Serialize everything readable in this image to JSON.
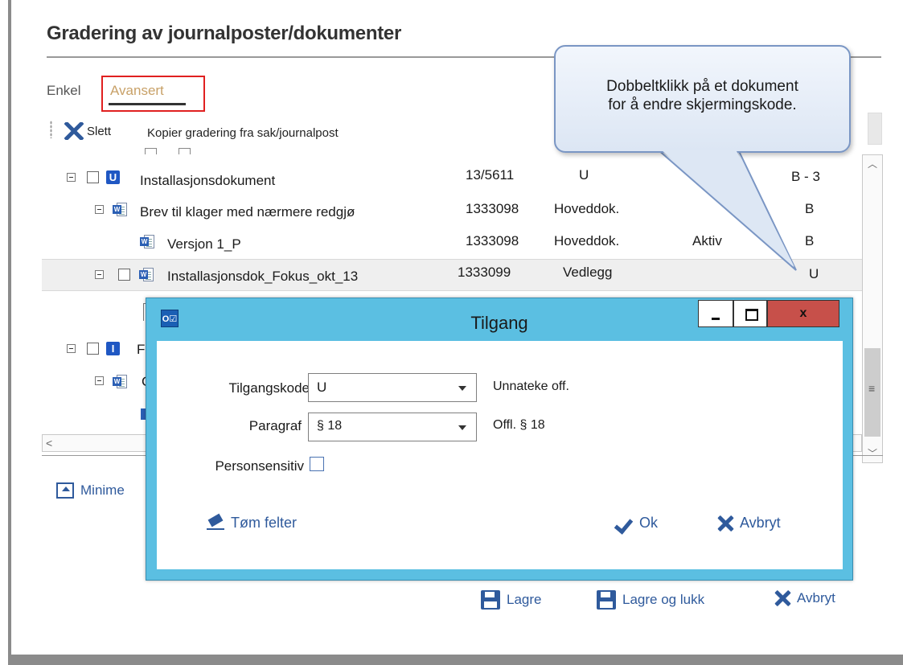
{
  "page": {
    "title": "Gradering av journalposter/dokumenter"
  },
  "tabs": {
    "enkel": "Enkel",
    "avansert": "Avansert"
  },
  "toolbar": {
    "delete_label": "Slett",
    "copy_label": "Kopier gradering fra sak/journalpost"
  },
  "callout": {
    "line1": "Dobbeltklikk på et dokument",
    "line2": "for å endre skjermingskode."
  },
  "grid": {
    "rows": [
      {
        "name": "Installasjonsdokument",
        "number": "13/5611",
        "type": "U",
        "status": "",
        "code": "B - 3"
      },
      {
        "name": "Brev til klager med nærmere redgjø",
        "number": "1333098",
        "type": "Hoveddok.",
        "status": "",
        "code": "B"
      },
      {
        "name": "Versjon 1_P",
        "number": "1333098",
        "type": "Hoveddok.",
        "status": "Aktiv",
        "code": "B"
      },
      {
        "name": "Installasjonsdok_Fokus_okt_13",
        "number": "1333099",
        "type": "Vedlegg",
        "status": "",
        "code": "U"
      }
    ],
    "partial_row_letter_r": "F",
    "partial_row_letter_c": "C"
  },
  "minimize": {
    "label": "Minime"
  },
  "bottom_actions": {
    "save": "Lagre",
    "save_close": "Lagre og lukk",
    "cancel": "Avbryt"
  },
  "dialog": {
    "app_icon": "O☑",
    "title": "Tilgang",
    "close_glyph": "x",
    "tilgangskode": {
      "label": "Tilgangskode",
      "value": "U",
      "description": "Unnateke off."
    },
    "paragraf": {
      "label": "Paragraf",
      "value": "§ 18",
      "description": "Offl. § 18"
    },
    "personsensitiv": {
      "label": "Personsensitiv",
      "checked": false
    },
    "clear_label": "Tøm felter",
    "ok_label": "Ok",
    "cancel_label": "Avbryt"
  },
  "colors": {
    "accent": "#2f5a9c",
    "tab_active": "#c8a168",
    "dialog_frame": "#5bbfe2",
    "close_button": "#c7504a",
    "highlight": "#e02020"
  }
}
